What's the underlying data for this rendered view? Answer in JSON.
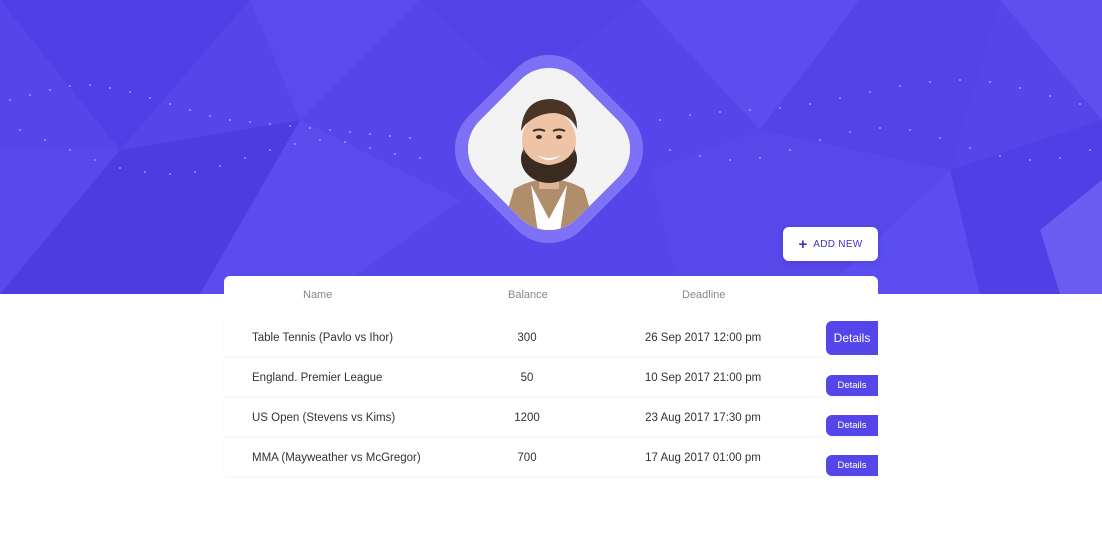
{
  "colors": {
    "brand": "#5446e8",
    "brand_dark": "#3d32c9",
    "background": "#ffffff",
    "header_text": "#888888",
    "row_text": "#333333"
  },
  "profile": {
    "avatar": "user-avatar-photo"
  },
  "toolbar": {
    "add_new_icon": "plus-icon",
    "add_new_label": "ADD NEW"
  },
  "table": {
    "columns": {
      "name": "Name",
      "balance": "Balance",
      "deadline": "Deadline"
    },
    "rows": [
      {
        "name": "Table Tennis (Pavlo vs Ihor)",
        "balance": "300",
        "deadline": "26 Sep 2017 12:00 pm",
        "action": "Details"
      },
      {
        "name": "England. Premier League",
        "balance": "50",
        "deadline": "10 Sep 2017 21:00 pm",
        "action": "Details"
      },
      {
        "name": "US Open (Stevens vs Kims)",
        "balance": "1200",
        "deadline": "23 Aug 2017 17:30 pm",
        "action": "Details"
      },
      {
        "name": "MMA (Mayweather vs McGregor)",
        "balance": "700",
        "deadline": "17 Aug 2017 01:00 pm",
        "action": "Details"
      }
    ]
  }
}
